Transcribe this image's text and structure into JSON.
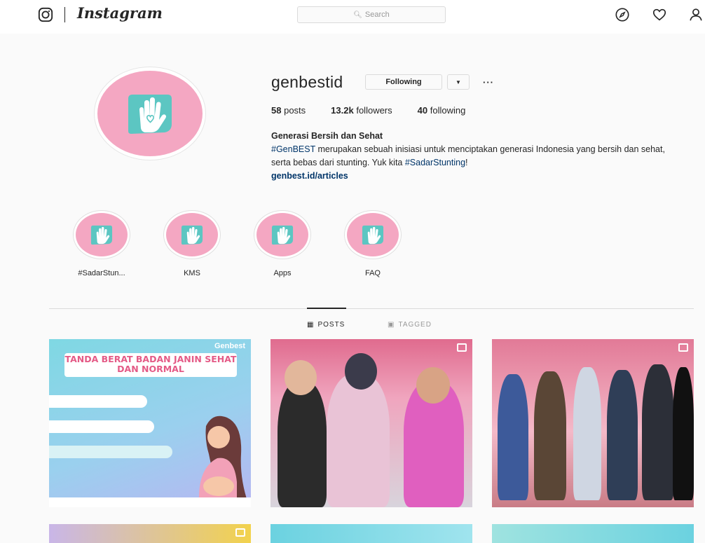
{
  "topbar": {
    "logo": "Instagram",
    "search_placeholder": "Search",
    "icons": [
      "instagram-camera-icon",
      "compass-icon",
      "heart-icon",
      "person-icon"
    ]
  },
  "profile": {
    "username": "genbestid",
    "following_label": "Following",
    "more_label": "···",
    "stats": {
      "posts_count": "58",
      "posts_label": "posts",
      "followers_count": "13.2k",
      "followers_label": "followers",
      "following_count": "40",
      "following_label": "following"
    },
    "bio": {
      "name": "Generasi Bersih dan Sehat",
      "hashtag1": "#GenBEST",
      "text1": " merupakan sebuah inisiasi untuk menciptakan generasi Indonesia yang bersih dan sehat, serta bebas dari stunting. Yuk kita ",
      "hashtag2": "#SadarStunting",
      "text2": "!",
      "link": "genbest.id/articles"
    }
  },
  "highlights": [
    {
      "label": "#SadarStun..."
    },
    {
      "label": "KMS"
    },
    {
      "label": "Apps"
    },
    {
      "label": "FAQ"
    }
  ],
  "tabs": {
    "posts": "POSTS",
    "tagged": "TAGGED"
  },
  "posts": {
    "p1_title": "TANDA BERAT BADAN JANIN SEHAT DAN NORMAL",
    "p1_brand": "Genbest"
  },
  "colors": {
    "accent_pink": "#f4a7c2",
    "brand_teal": "#5cc6c2",
    "link_blue": "#003569"
  }
}
